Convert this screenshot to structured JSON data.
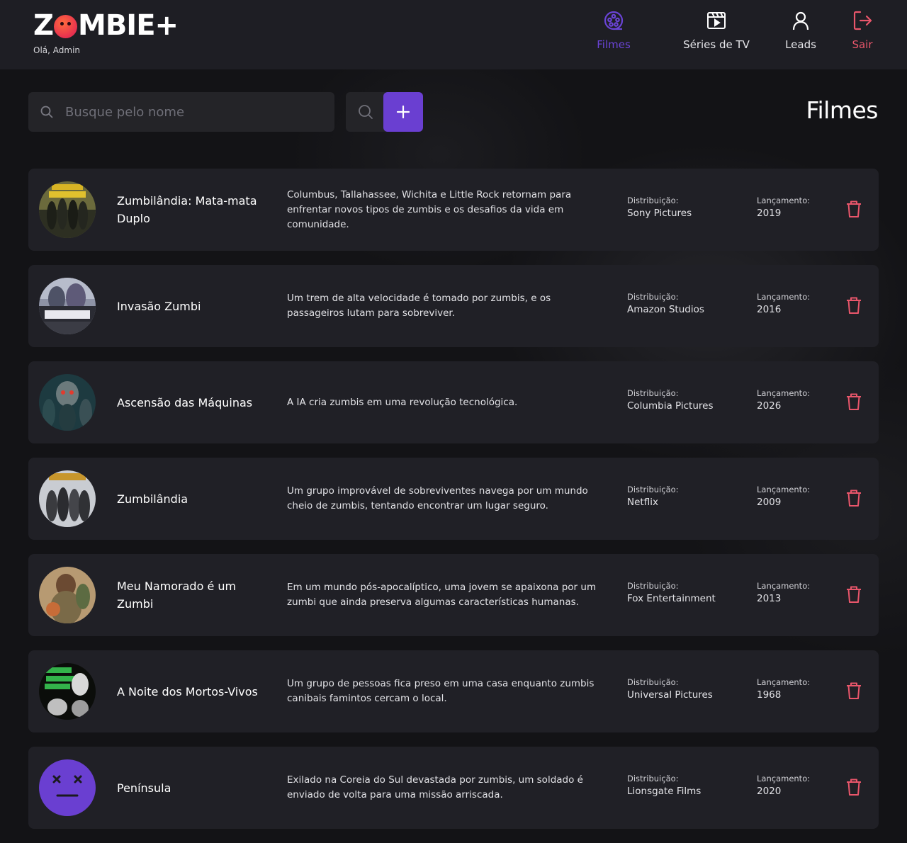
{
  "header": {
    "logo_text_start": "Z",
    "logo_text_end": "MBIE+",
    "greeting": "Olá, Admin",
    "nav": [
      {
        "label": "Filmes",
        "icon": "film-reel-icon",
        "active": true
      },
      {
        "label": "Séries de TV",
        "icon": "clapperboard-icon",
        "active": false
      },
      {
        "label": "Leads",
        "icon": "user-icon",
        "active": false
      },
      {
        "label": "Sair",
        "icon": "logout-icon",
        "active": false
      }
    ]
  },
  "toolbar": {
    "search_placeholder": "Busque pelo nome",
    "page_title": "Filmes"
  },
  "labels": {
    "distribution": "Distribuição:",
    "release": "Lançamento:"
  },
  "colors": {
    "accent": "#6a3fd1",
    "danger": "#e9566b",
    "background": "#131316",
    "card": "#202026"
  },
  "movies": [
    {
      "title": "Zumbilândia: Mata-mata Duplo",
      "description": "Columbus, Tallahassee, Wichita e Little Rock retornam para enfrentar novos tipos de zumbis e os desafios da vida em comunidade.",
      "distribution": "Sony Pictures",
      "release": "2019"
    },
    {
      "title": "Invasão Zumbi",
      "description": "Um trem de alta velocidade é tomado por zumbis, e os passageiros lutam para sobreviver.",
      "distribution": "Amazon Studios",
      "release": "2016"
    },
    {
      "title": "Ascensão das Máquinas",
      "description": "A IA cria zumbis em uma revolução tecnológica.",
      "distribution": "Columbia Pictures",
      "release": "2026"
    },
    {
      "title": "Zumbilândia",
      "description": "Um grupo improvável de sobreviventes navega por um mundo cheio de zumbis, tentando encontrar um lugar seguro.",
      "distribution": "Netflix",
      "release": "2009"
    },
    {
      "title": "Meu Namorado é um Zumbi",
      "description": "Em um mundo pós-apocalíptico, uma jovem se apaixona por um zumbi que ainda preserva algumas características humanas.",
      "distribution": "Fox Entertainment",
      "release": "2013"
    },
    {
      "title": "A Noite dos Mortos-Vivos",
      "description": "Um grupo de pessoas fica preso em uma casa enquanto zumbis canibais famintos cercam o local.",
      "distribution": "Universal Pictures",
      "release": "1968"
    },
    {
      "title": "Península",
      "description": "Exilado na Coreia do Sul devastada por zumbis, um soldado é enviado de volta para uma missão arriscada.",
      "distribution": "Lionsgate Films",
      "release": "2020"
    }
  ]
}
